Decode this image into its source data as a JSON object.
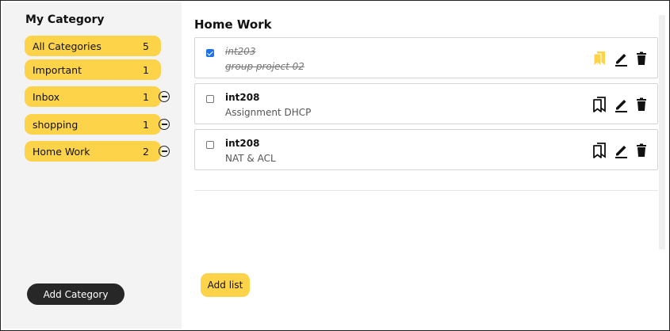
{
  "sidebar": {
    "title": "My Category",
    "categories": [
      {
        "label": "All Categories",
        "count": "5",
        "removable": false
      },
      {
        "label": "Important",
        "count": "1",
        "removable": false
      },
      {
        "label": "Inbox",
        "count": "1",
        "removable": true
      },
      {
        "label": "shopping",
        "count": "1",
        "removable": true
      },
      {
        "label": "Home Work",
        "count": "2",
        "removable": true
      }
    ],
    "add_label": "Add Category"
  },
  "main": {
    "title": "Home Work",
    "tasks": [
      {
        "title": "int203",
        "desc": "group project 02",
        "done": true,
        "bookmarked": true
      },
      {
        "title": "int208",
        "desc": "Assignment DHCP",
        "done": false,
        "bookmarked": false
      },
      {
        "title": "int208",
        "desc": "NAT & ACL",
        "done": false,
        "bookmarked": false
      }
    ],
    "add_label": "Add list"
  },
  "colors": {
    "accent": "#fdd34a",
    "dark_button": "#272727",
    "sidebar_bg": "#f3f3f3",
    "checkbox_checked": "#1f73e8"
  }
}
